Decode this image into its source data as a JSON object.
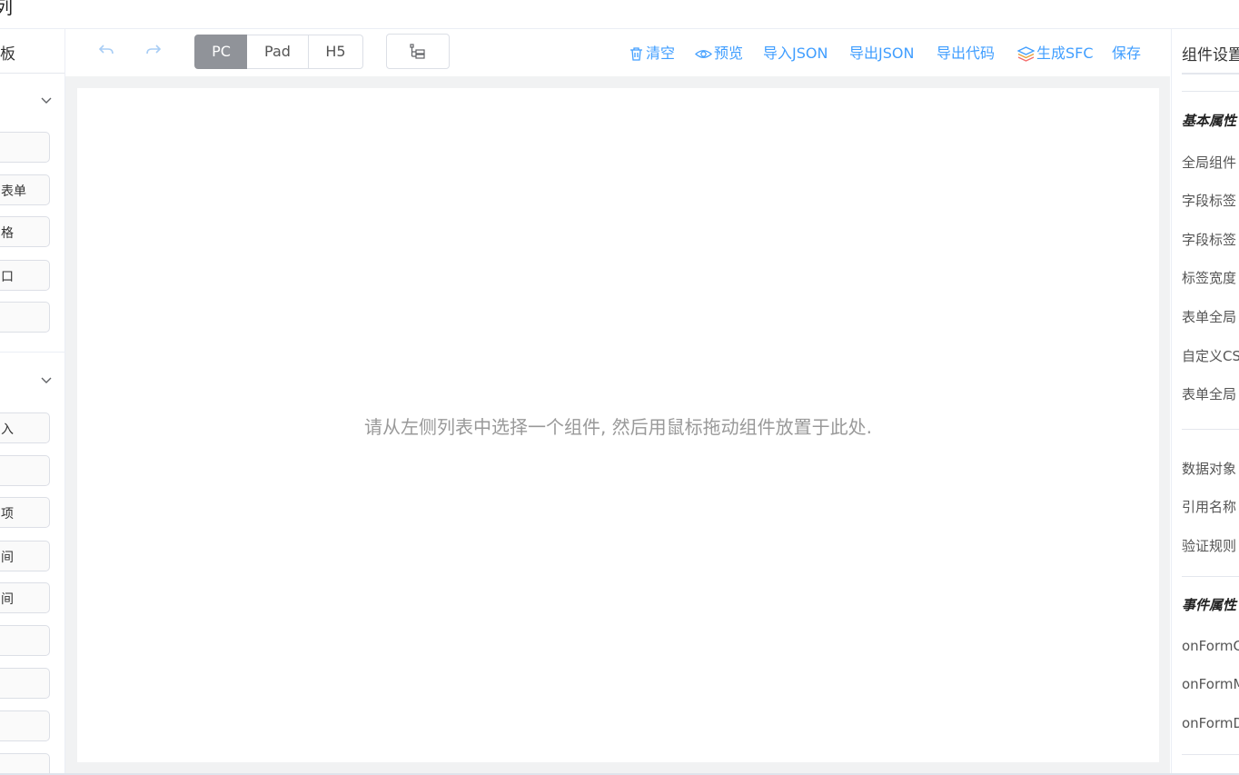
{
  "app": {
    "title_fragment": "列"
  },
  "left_panel": {
    "title": "板",
    "sections": [
      {
        "name": "container-section",
        "widgets": [
          "",
          "表单",
          "格",
          "口",
          ""
        ]
      },
      {
        "name": "basic-section",
        "widgets": [
          "入",
          "",
          "项",
          "间",
          "间",
          "",
          "",
          "",
          ""
        ]
      }
    ]
  },
  "toolbar": {
    "undo_icon": "undo-icon",
    "redo_icon": "redo-icon",
    "devices": [
      "PC",
      "Pad",
      "H5"
    ],
    "active_device": "PC",
    "tree_icon": "node-tree-icon",
    "actions": {
      "clear": "清空",
      "preview": "预览",
      "import_json": "导入JSON",
      "export_json": "导出JSON",
      "export_code": "导出代码",
      "generate_sfc": "生成SFC",
      "save": "保存"
    }
  },
  "canvas": {
    "hint": "请从左侧列表中选择一个组件, 然后用鼠标拖动组件放置于此处."
  },
  "right_panel": {
    "tab": "组件设置",
    "basic_heading": "基本属性",
    "basic_rows": [
      "全局组件",
      "字段标签",
      "字段标签",
      "标签宽度",
      "表单全局",
      "自定义CSS",
      "表单全局"
    ],
    "data_rows": [
      "数据对象",
      "引用名称",
      "验证规则"
    ],
    "event_heading": "事件属性",
    "event_rows": [
      "onFormCreated",
      "onFormMounted",
      "onFormDataChange"
    ]
  },
  "colors": {
    "accent": "#409eff",
    "active_segment": "#909399",
    "canvas_bg": "#f1f2f3"
  }
}
